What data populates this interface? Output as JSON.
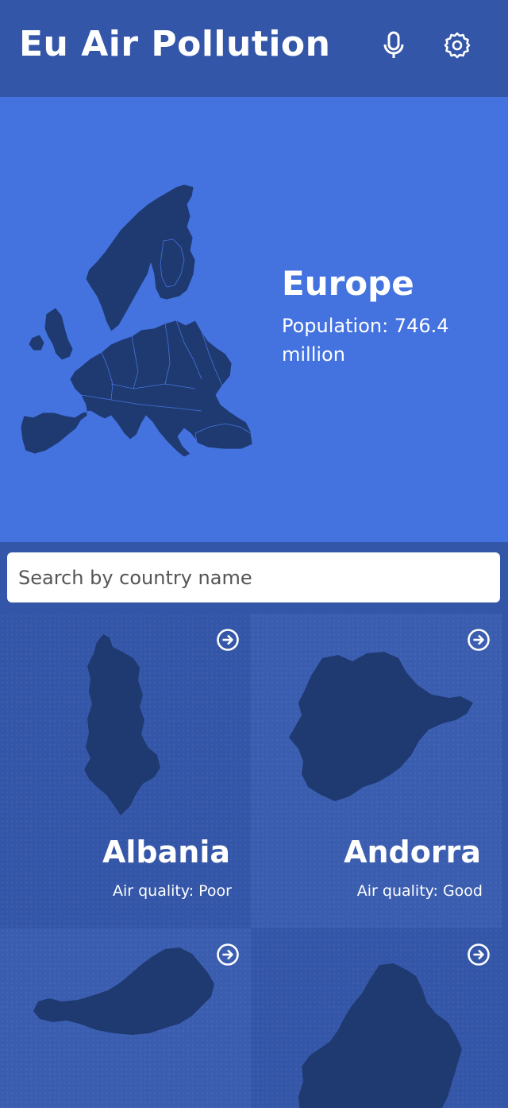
{
  "header": {
    "title": "Eu Air Pollution",
    "mic_icon": "microphone-icon",
    "settings_icon": "gear-icon"
  },
  "hero": {
    "region": "Europe",
    "population_text": "Population: 746.4 million"
  },
  "search": {
    "placeholder": "Search by country name",
    "value": ""
  },
  "countries": [
    {
      "name": "Albania",
      "quality_label": "Air quality: ",
      "quality": "Poor"
    },
    {
      "name": "Andorra",
      "quality_label": "Air quality: ",
      "quality": "Good"
    },
    {
      "name": "",
      "quality_label": "",
      "quality": ""
    },
    {
      "name": "",
      "quality_label": "",
      "quality": ""
    }
  ],
  "colors": {
    "header_bg": "#3456a8",
    "hero_bg": "#4473e0",
    "map_fill": "#1f3a70",
    "text": "#ffffff"
  }
}
